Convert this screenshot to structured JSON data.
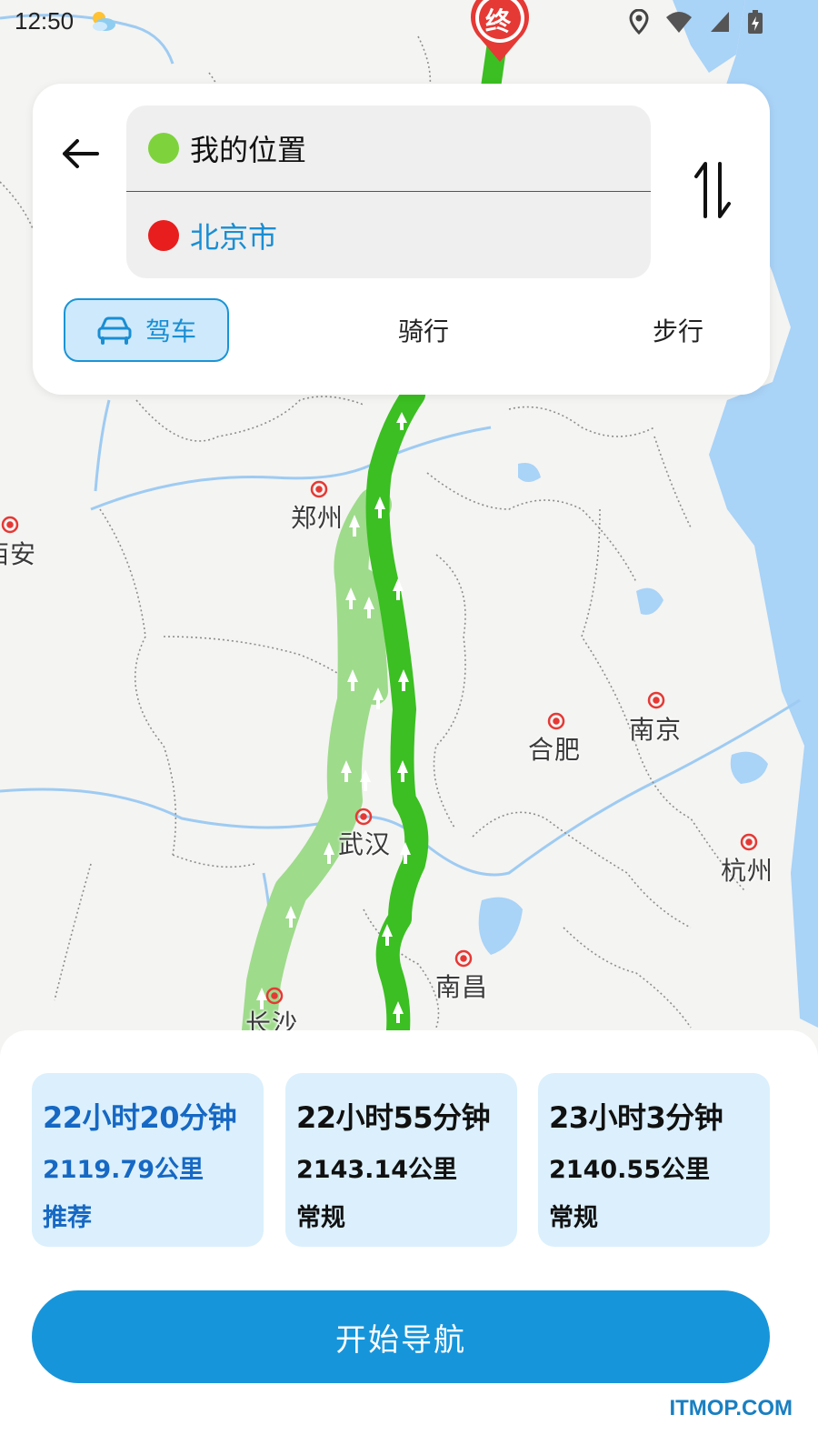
{
  "status_bar": {
    "time": "12:50",
    "icons": [
      "weather-icon",
      "location-icon",
      "wifi-icon",
      "signal-icon",
      "battery-icon"
    ]
  },
  "route_search": {
    "origin": "我的位置",
    "destination": "北京市",
    "origin_dot_color": "#7ed33c",
    "destination_dot_color": "#e81e1e",
    "destination_text_color": "#1a8ed3"
  },
  "travel_modes": {
    "selected": "驾车",
    "drive": "驾车",
    "bike": "骑行",
    "walk": "步行"
  },
  "map": {
    "end_marker": "终",
    "cities": {
      "zhengzhou": "郑州",
      "xian": "西安",
      "hefei": "合肥",
      "nanjing": "南京",
      "wuhan": "武汉",
      "hangzhou": "杭州",
      "nanchang": "南昌",
      "changsha": "长沙"
    }
  },
  "routes": [
    {
      "time": "22小时20分钟",
      "distance": "2119.79公里",
      "tag": "推荐",
      "selected": true
    },
    {
      "time": "22小时55分钟",
      "distance": "2143.14公里",
      "tag": "常规",
      "selected": false
    },
    {
      "time": "23小时3分钟",
      "distance": "2140.55公里",
      "tag": "常规",
      "selected": false
    }
  ],
  "actions": {
    "start_navigation": "开始导航"
  },
  "watermark": "ITMOP.COM",
  "colors": {
    "accent": "#1795da",
    "route_primary": "#3bbf22",
    "route_alt": "#9edb8b",
    "water": "#a9d3f7"
  }
}
